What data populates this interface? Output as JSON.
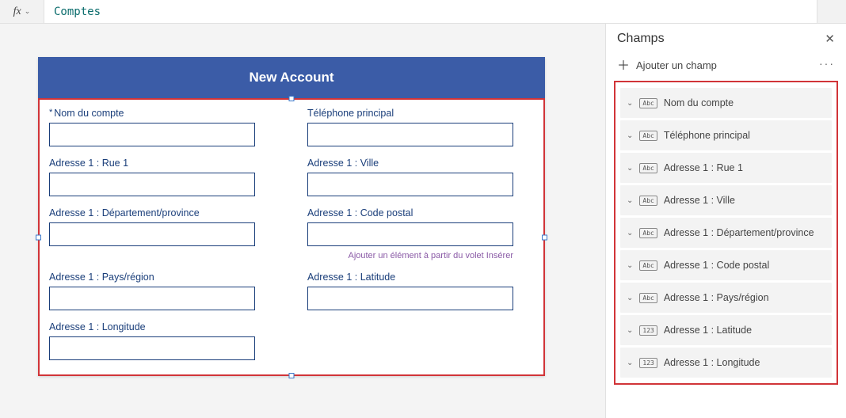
{
  "formula_bar": {
    "fx": "fx",
    "value": "Comptes"
  },
  "canvas": {
    "title": "New Account",
    "insert_hint": "Ajouter un élément à partir du volet Insérer"
  },
  "form_fields": [
    {
      "label": "Nom du compte",
      "required": true
    },
    {
      "label": "Téléphone principal",
      "required": false
    },
    {
      "label": "Adresse 1 : Rue 1",
      "required": false
    },
    {
      "label": "Adresse 1 : Ville",
      "required": false
    },
    {
      "label": "Adresse 1 : Département/province",
      "required": false
    },
    {
      "label": "Adresse 1 : Code postal",
      "required": false,
      "hint": true
    },
    {
      "label": "Adresse 1 : Pays/région",
      "required": false
    },
    {
      "label": "Adresse 1 : Latitude",
      "required": false
    },
    {
      "label": "Adresse 1 : Longitude",
      "required": false
    }
  ],
  "panel": {
    "title": "Champs",
    "add_label": "Ajouter un champ",
    "fields": [
      {
        "type": "Abc",
        "label": "Nom du compte"
      },
      {
        "type": "Abc",
        "label": "Téléphone principal"
      },
      {
        "type": "Abc",
        "label": "Adresse 1 : Rue 1"
      },
      {
        "type": "Abc",
        "label": "Adresse 1 : Ville"
      },
      {
        "type": "Abc",
        "label": "Adresse 1 : Département/province"
      },
      {
        "type": "Abc",
        "label": "Adresse 1 : Code postal"
      },
      {
        "type": "Abc",
        "label": "Adresse 1 : Pays/région"
      },
      {
        "type": "123",
        "label": "Adresse 1 : Latitude"
      },
      {
        "type": "123",
        "label": "Adresse 1 : Longitude"
      }
    ]
  }
}
